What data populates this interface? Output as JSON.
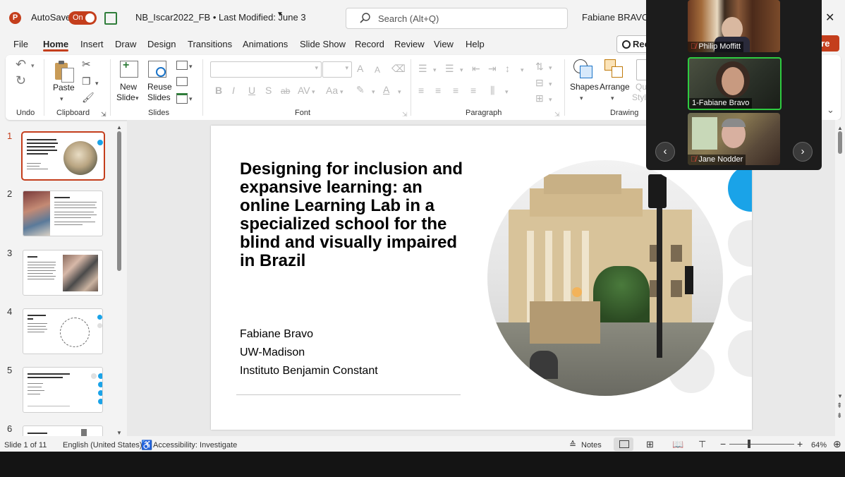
{
  "titlebar": {
    "app_icon": "powerpoint-icon",
    "autosave_label": "AutoSave",
    "autosave_state": "On",
    "document_title": "NB_Iscar2022_FB • Last Modified: June 3",
    "search_placeholder": "Search (Alt+Q)",
    "user_name": "Fabiane BRAVO DE",
    "close_glyph": "✕"
  },
  "menu": {
    "items": [
      "File",
      "Home",
      "Insert",
      "Draw",
      "Design",
      "Transitions",
      "Animations",
      "Slide Show",
      "Record",
      "Review",
      "View",
      "Help"
    ],
    "record_button": "Rec",
    "share_button": "are"
  },
  "ribbon": {
    "groups": {
      "undo": "Undo",
      "clipboard": "Clipboard",
      "slides": "Slides",
      "font": "Font",
      "paragraph": "Paragraph",
      "drawing": "Drawing"
    },
    "paste": "Paste",
    "new_slide": [
      "New",
      "Slide"
    ],
    "reuse_slides": [
      "Reuse",
      "Slides"
    ],
    "shapes": "Shapes",
    "arrange": "Arrange",
    "quick_styles": [
      "Qu",
      "Styl"
    ],
    "font_buttons": [
      "B",
      "I",
      "U",
      "S",
      "ab",
      "AV",
      "Aa",
      "A"
    ],
    "font_size_grow": "A",
    "font_size_shrink": "A"
  },
  "thumbnails": {
    "numbers": [
      "1",
      "2",
      "3",
      "4",
      "5",
      "6"
    ],
    "titles": [
      "Designing for inclusion and expansive learning: an online Learning Lab in a specialized school for the blind and visually impaired in Brazil",
      "Context",
      "Aims",
      "Online Learning Lab",
      "Tools of a virtual environment facilitating agency and ownership",
      "Mapping out"
    ]
  },
  "slide": {
    "title": "Designing for inclusion and expansive learning: an online Learning Lab in a specialized school for the blind and visually impaired in Brazil",
    "authors": [
      "Fabiane Bravo",
      "UW-Madison",
      "Instituto Benjamin Constant"
    ],
    "accent_color": "#1aa3e8"
  },
  "status": {
    "slide_counter": "Slide 1 of 11",
    "language": "English (United States)",
    "accessibility": "Accessibility: Investigate",
    "notes": "Notes",
    "zoom_level": "64%"
  },
  "video": {
    "participants": [
      {
        "name": "Philip Moffitt",
        "muted": true,
        "active": false
      },
      {
        "name": "1-Fabiane Bravo",
        "muted": false,
        "active": true
      },
      {
        "name": "Jane Nodder",
        "muted": true,
        "active": false
      }
    ],
    "prev_glyph": "‹",
    "next_glyph": "›"
  },
  "colors": {
    "accent": "#c43e1c",
    "speaker_border": "#2ecc40"
  }
}
